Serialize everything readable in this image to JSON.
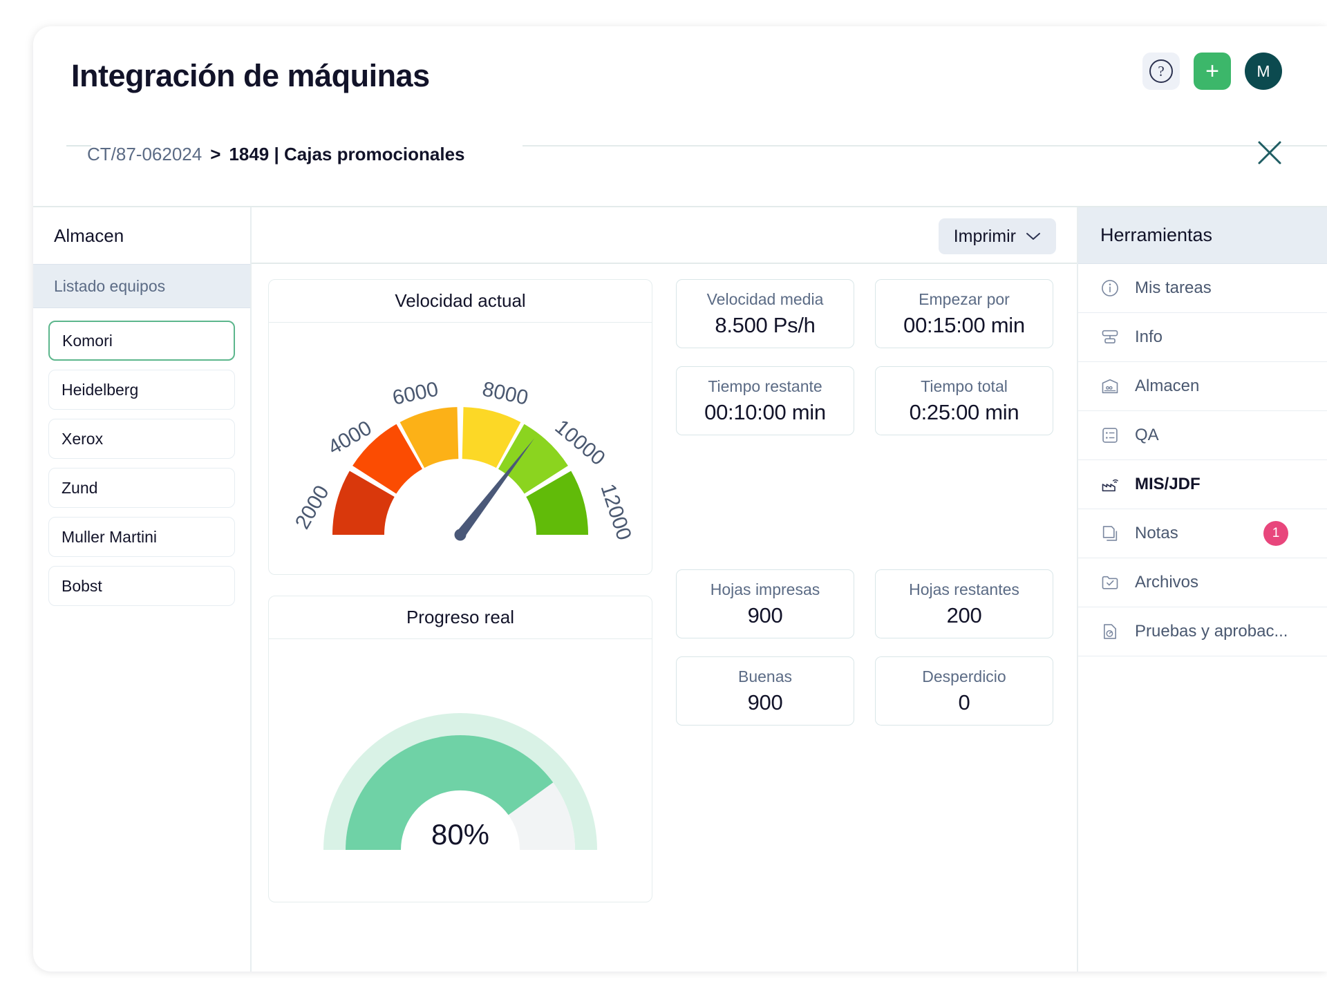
{
  "header": {
    "title": "Integración de máquinas",
    "help_icon": "question-circle-icon",
    "add_label": "+",
    "avatar_initial": "M"
  },
  "breadcrumb": {
    "root": "CT/87-062024",
    "separator": ">",
    "current": "1849 | Cajas promocionales",
    "close_label": "×"
  },
  "left_panel": {
    "title": "Almacen",
    "list_header": "Listado equipos",
    "machines": [
      {
        "label": "Komori",
        "selected": true
      },
      {
        "label": "Heidelberg",
        "selected": false
      },
      {
        "label": "Xerox",
        "selected": false
      },
      {
        "label": "Zund",
        "selected": false
      },
      {
        "label": "Muller Martini",
        "selected": false
      },
      {
        "label": "Bobst",
        "selected": false
      }
    ]
  },
  "toolbar": {
    "print_label": "Imprimir"
  },
  "stats": [
    {
      "label": "Velocidad media",
      "value": "8.500 Ps/h"
    },
    {
      "label": "Empezar por",
      "value": "00:15:00 min"
    },
    {
      "label": "Tiempo restante",
      "value": "00:10:00 min"
    },
    {
      "label": "Tiempo total",
      "value": "0:25:00 min"
    },
    {
      "label": "Hojas impresas",
      "value": "900"
    },
    {
      "label": "Hojas restantes",
      "value": "200"
    },
    {
      "label": "Buenas",
      "value": "900"
    },
    {
      "label": "Desperdicio",
      "value": "0"
    }
  ],
  "tools_panel": {
    "title": "Herramientas",
    "items": [
      {
        "label": "Mis tareas",
        "icon": "info-circle-icon",
        "active": false,
        "badge": null
      },
      {
        "label": "Info",
        "icon": "server-icon",
        "active": false,
        "badge": null
      },
      {
        "label": "Almacen",
        "icon": "warehouse-icon",
        "active": false,
        "badge": null
      },
      {
        "label": "QA",
        "icon": "checklist-icon",
        "active": false,
        "badge": null
      },
      {
        "label": "MIS/JDF",
        "icon": "factory-wifi-icon",
        "active": true,
        "badge": null
      },
      {
        "label": "Notas",
        "icon": "notes-icon",
        "active": false,
        "badge": "1"
      },
      {
        "label": "Archivos",
        "icon": "folder-check-icon",
        "active": false,
        "badge": null
      },
      {
        "label": "Pruebas y aprobac...",
        "icon": "proof-icon",
        "active": false,
        "badge": null
      }
    ]
  },
  "chart_data": [
    {
      "type": "gauge",
      "title": "Velocidad actual",
      "value": 8500,
      "min": 0,
      "max": 12000,
      "unit": "Ps/h",
      "tick_labels": [
        "2000",
        "4000",
        "6000",
        "8000",
        "10000",
        "12000"
      ],
      "ticks": [
        2000,
        4000,
        6000,
        8000,
        10000,
        12000
      ],
      "segments": [
        {
          "from": 0,
          "to": 2000,
          "color": "#d9380c"
        },
        {
          "from": 2000,
          "to": 4000,
          "color": "#fb4c02"
        },
        {
          "from": 4000,
          "to": 6000,
          "color": "#fcb117"
        },
        {
          "from": 6000,
          "to": 8000,
          "color": "#fcd826"
        },
        {
          "from": 8000,
          "to": 10000,
          "color": "#8bd41f"
        },
        {
          "from": 10000,
          "to": 12000,
          "color": "#61bb09"
        }
      ],
      "needle_color": "#4a5878"
    },
    {
      "type": "gauge",
      "title": "Progreso real",
      "value": 80,
      "min": 0,
      "max": 100,
      "unit": "%",
      "center_label": "80%",
      "arc_color": "#6fd2a6",
      "track_color": "#f2f4f5",
      "halo_color": "#d9f2e6"
    }
  ]
}
